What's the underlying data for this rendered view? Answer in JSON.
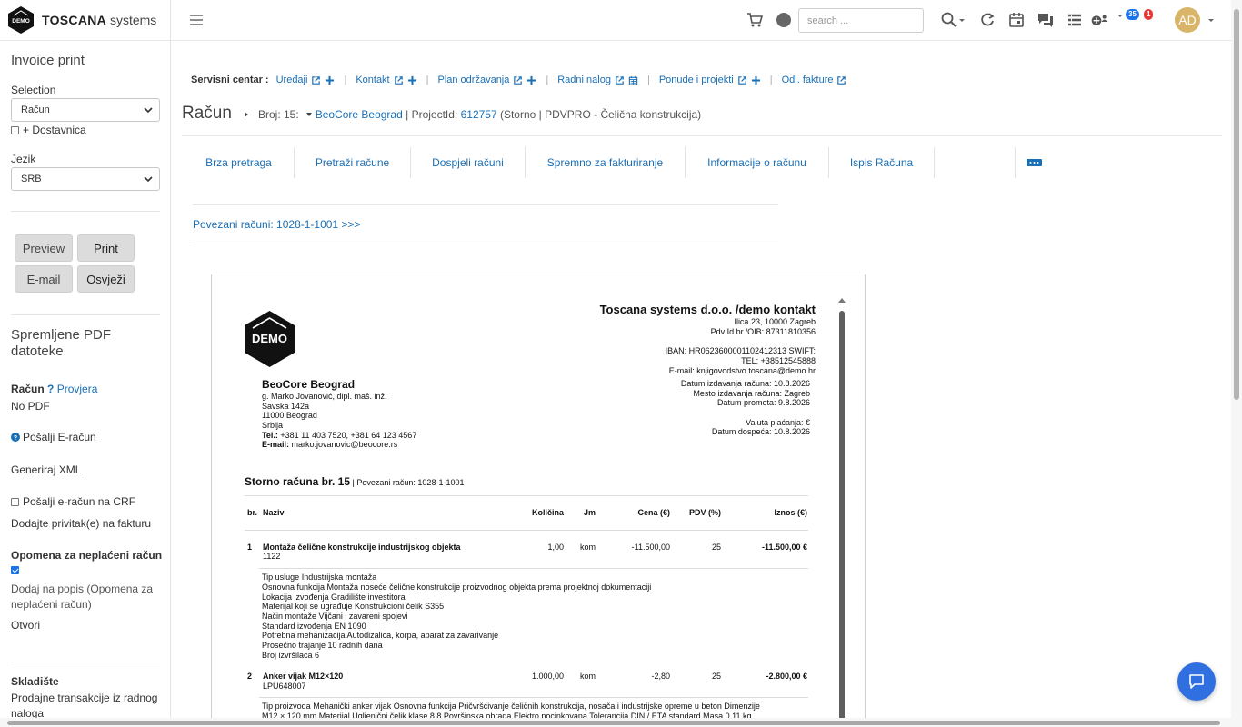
{
  "brand": {
    "logo_text": "DEMO",
    "name_bold": "TOSCANA",
    "name_rest": " systems"
  },
  "sidebar": {
    "title": "Invoice print",
    "selection_label": "Selection",
    "selection_value": "Račun",
    "dostavnica_label": "+ Dostavnica",
    "jezik_label": "Jezik",
    "jezik_value": "SRB",
    "buttons": {
      "preview": "Preview",
      "print": "Print",
      "email": "E-mail",
      "osvjezi": "Osvježi"
    },
    "spremljene_title": "Spremljene PDF datoteke",
    "racun_label": "Račun",
    "help_mark": "?",
    "provjera": "Provjera",
    "no_pdf": "No PDF",
    "posalji_eracun": "Pošalji E-račun",
    "generiraj_xml": "Generiraj XML",
    "posalji_crf": "Pošalji e-račun na CRF",
    "dodajte_privitak": "Dodajte privitak(e) na fakturu",
    "opomena_title": "Opomena za neplaćeni račun",
    "dodaj_na_popis": "Dodaj na popis (Opomena za neplaćeni račun)",
    "otvori": "Otvori",
    "skladiste_title": "Skladište",
    "prodajne": "Prodajne transakcije iz radnog naloga"
  },
  "topbar": {
    "search_placeholder": "search ...",
    "badge_blue": "35",
    "badge_red": "1",
    "avatar": "AD"
  },
  "servisni": {
    "label": "Servisni centar :",
    "items": [
      "Uređaji",
      "Kontakt",
      "Plan održavanja",
      "Radni nalog",
      "Ponude i projekti",
      "Odl. fakture"
    ]
  },
  "header": {
    "title": "Račun",
    "broj": "Broj: 15:",
    "client": "BeoCore Beograd",
    "project_label": " | ProjectId: ",
    "project_id": "612757",
    "tail": " (Storno | PDVPRO - Čelična konstrukcija)"
  },
  "tabs": [
    "Brza pretraga",
    "Pretraži račune",
    "Dospjeli računi",
    "Spremno za fakturiranje",
    "Informacije o računu",
    "Ispis Računa"
  ],
  "povezani": "Povezani računi: 1028-1-1001 >>>",
  "invoice": {
    "logo_text": "DEMO",
    "company": "Toscana systems d.o.o. /demo kontakt",
    "company_lines": [
      "Ilica 23, 10000 Zagreb",
      "Pdv Id br./OIB: 87311810356",
      "",
      "IBAN: HR0623600001102412313 SWIFT:",
      "TEL: +38512545888",
      "E-mail: knjigovodstvo.toscana@demo.hr"
    ],
    "date_lines": [
      "Datum izdavanja računa: 10.8.2026",
      "Mesto izdavanja računa: Zagreb",
      "Datum prometa: 9.8.2026",
      "",
      "Valuta plaćanja: €",
      "Datum dospeća: 10.8.2026"
    ],
    "client_name": "BeoCore Beograd",
    "client_lines": [
      "g.  Marko Jovanović, dipl. maš. inž.",
      "Savska 142a",
      "11000 Beograd",
      "Srbija"
    ],
    "tel_label": "Tel.:",
    "tel_value": " +381 11 403 7520, +381 64 123 4567",
    "email_label": "E-mail:",
    "email_value": " marko.jovanovic@beocore.rs",
    "doc_title": "Storno računa br. 15",
    "doc_title_tail": " | Povezani račun: 1028-1-1001",
    "columns": [
      "br.",
      "Naziv",
      "Količina",
      "Jm",
      "Cena (€)",
      "PDV (%)",
      "Iznos (€)"
    ],
    "rows": [
      {
        "br": "1",
        "naziv": "Montaža čelične konstrukcije industrijskog objekta",
        "code": "1122",
        "kolicina": "1,00",
        "jm": "kom",
        "cena": "-11.500,00",
        "pdv": "25",
        "iznos": "-11.500,00 €",
        "desc": [
          "Tip usluge Industrijska montaža",
          "Osnovna funkcija Montaža noseće čelične konstrukcije proizvodnog objekta prema projektnoj dokumentaciji",
          "Lokacija izvođenja Gradilište investitora",
          "Materijal koji se ugrađuje Konstrukcioni čelik S355",
          "Način montaže Vijčani i zavareni spojevi",
          "Standard izvođenja EN 1090",
          "Potrebna mehanizacija Autodizalica, korpa, aparat za zavarivanje",
          "Prosečno trajanje 10 radnih dana",
          "Broj izvršilaca 6"
        ]
      },
      {
        "br": "2",
        "naziv": "Anker vijak M12×120",
        "code": "LPU648007",
        "kolicina": "1.000,00",
        "jm": "kom",
        "cena": "-2,80",
        "pdv": "25",
        "iznos": "-2.800,00 €",
        "desc": [
          "Tip proizvoda Mehanički anker vijak Osnovna funkcija Pričvršćivanje čeličnih konstrukcija, nosača i industrijske opreme u beton Dimenzije",
          "M12 × 120 mm Materijal Ugljenični čelik klase 8.8 Površinska obrada Elektro pocinkovana Tolerancija DIN / ETA standard Masa 0,11 kg"
        ]
      }
    ]
  },
  "colors": {
    "link": "#1a6fb5",
    "badge_blue": "#1a73e8",
    "badge_red": "#e53935",
    "avatar": "#d9b56a",
    "chat": "#2f6fe0"
  }
}
